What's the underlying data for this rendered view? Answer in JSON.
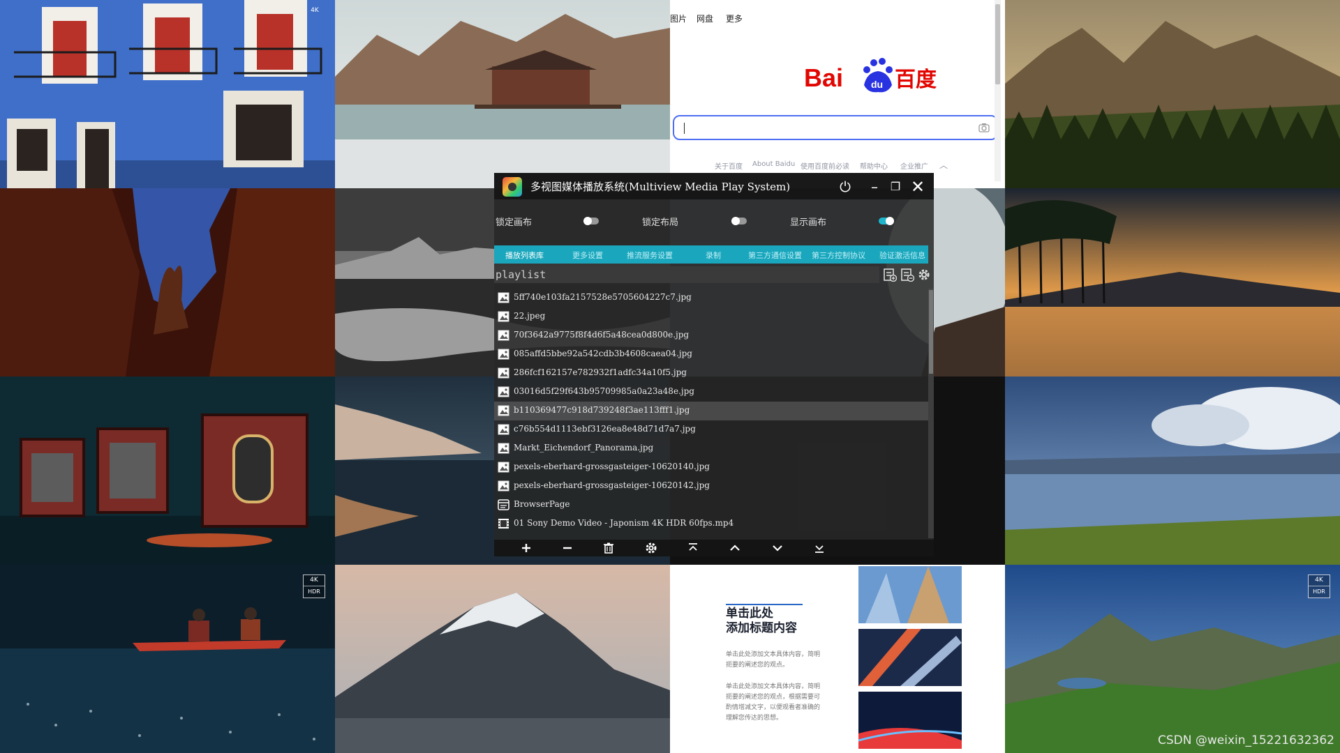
{
  "baidu": {
    "top_links": [
      "图片",
      "网盘",
      "更多"
    ],
    "logo_alt": "Baidu百度",
    "footer_links": [
      "关于百度",
      "About Baidu",
      "使用百度前必读",
      "帮助中心",
      "企业推广"
    ]
  },
  "document": {
    "title_line1": "单击此处",
    "title_line2": "添加标题内容",
    "para1": "单击此处添加文本具体内容，简明扼要的阐述您的观点。",
    "para2": "单击此处添加文本具体内容，简明扼要的阐述您的观点，根据需要可酌情增减文字，以便观看者准确的理解您传达的思想。"
  },
  "player": {
    "title": "多视图媒体播放系统(Multiview Media Play System)",
    "toggles": [
      {
        "label": "锁定画布",
        "on": false
      },
      {
        "label": "锁定布局",
        "on": false
      },
      {
        "label": "显示画布",
        "on": true
      }
    ],
    "tabs": [
      "播放列表库",
      "更多设置",
      "推流服务设置",
      "录制",
      "第三方通信设置",
      "第三方控制协议",
      "验证激活信息"
    ],
    "active_tab": 0,
    "playlist_label": "playlist",
    "items": [
      {
        "name": "5ff740e103fa2157528e5705604227c7.jpg",
        "type": "image"
      },
      {
        "name": "22.jpeg",
        "type": "image"
      },
      {
        "name": "70f3642a9775f8f4d6f5a48cea0d800e.jpg",
        "type": "image"
      },
      {
        "name": "085affd5bbe92a542cdb3b4608caea04.jpg",
        "type": "image"
      },
      {
        "name": "286fcf162157e782932f1adfc34a10f5.jpg",
        "type": "image"
      },
      {
        "name": "03016d5f29f643b95709985a0a23a48e.jpg",
        "type": "image"
      },
      {
        "name": "b110369477c918d739248f3ae113fff1.jpg",
        "type": "image"
      },
      {
        "name": "c76b554d1113ebf3126ea8e48d71d7a7.jpg",
        "type": "image"
      },
      {
        "name": "Markt_Eichendorf_Panorama.jpg",
        "type": "image"
      },
      {
        "name": "pexels-eberhard-grossgasteiger-10620140.jpg",
        "type": "image"
      },
      {
        "name": "pexels-eberhard-grossgasteiger-10620142.jpg",
        "type": "image"
      },
      {
        "name": "BrowserPage",
        "type": "browser"
      },
      {
        "name": "01 Sony Demo Video - Japonism 4K HDR 60fps.mp4",
        "type": "video"
      }
    ],
    "selected_index": 6,
    "bottom_icons": [
      "add-icon",
      "remove-icon",
      "trash-icon",
      "gear-icon",
      "move-top-icon",
      "move-up-icon",
      "move-down-icon",
      "move-bottom-icon"
    ]
  },
  "badges": {
    "line1": "4K",
    "line2": "HDR"
  },
  "watermark": "CSDN @weixin_15221632362",
  "colors": {
    "accent": "#1aa7bd",
    "baidu_blue": "#2932e1",
    "baidu_red": "#e10602",
    "search_border": "#4e6ef2"
  }
}
